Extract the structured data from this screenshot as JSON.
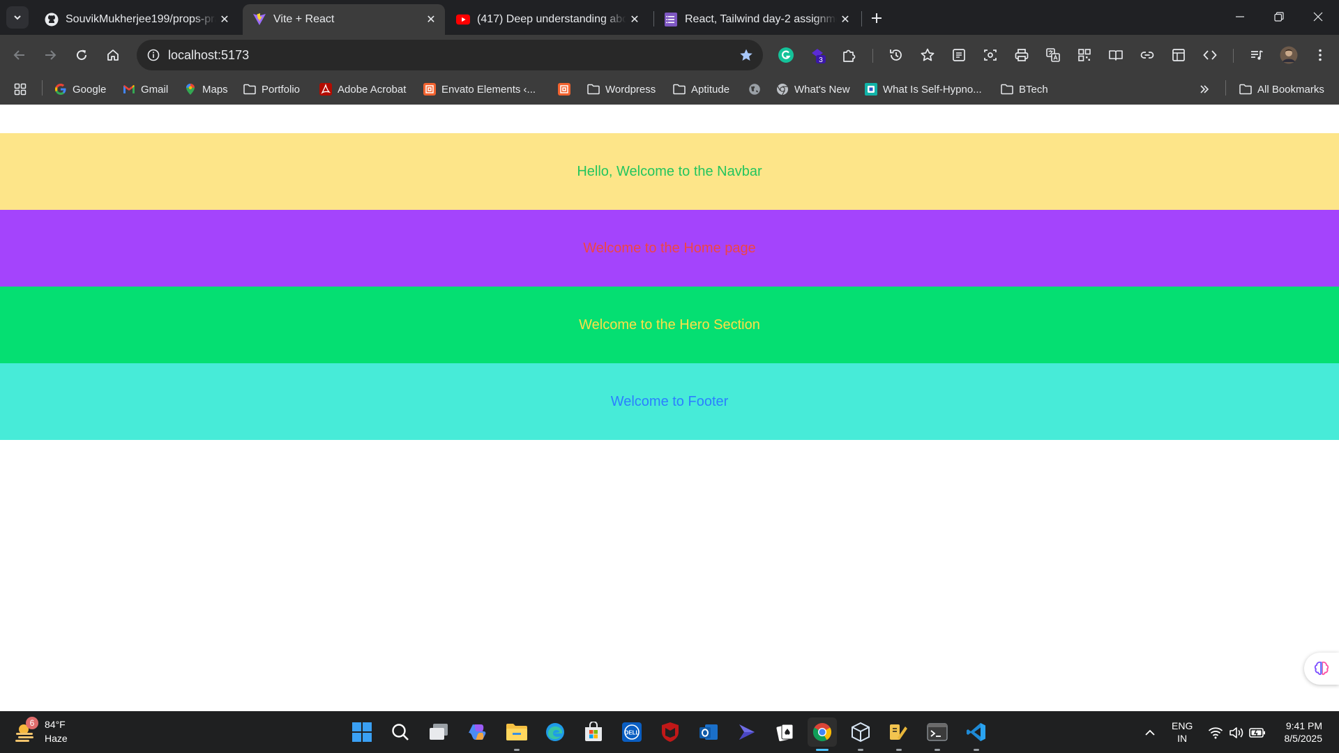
{
  "browser": {
    "tabs": [
      {
        "title": "SouvikMukherjee199/props-pra",
        "icon": "github-icon",
        "active": false
      },
      {
        "title": "Vite + React",
        "icon": "vite-icon",
        "active": true
      },
      {
        "title": "(417) Deep understanding abou",
        "icon": "youtube-icon",
        "active": false
      },
      {
        "title": "React, Tailwind day-2 assignme",
        "icon": "forms-icon",
        "active": false
      }
    ],
    "url": "localhost:5173",
    "extension_badge": "3",
    "bookmarks": [
      {
        "label": "Google",
        "icon": "google-icon"
      },
      {
        "label": "Gmail",
        "icon": "gmail-icon"
      },
      {
        "label": "Maps",
        "icon": "maps-icon"
      },
      {
        "label": "Portfolio",
        "icon": "folder-icon"
      },
      {
        "label": "Adobe Acrobat",
        "icon": "acrobat-icon"
      },
      {
        "label": "Envato Elements ‹...",
        "icon": "envato-icon"
      },
      {
        "label": "",
        "icon": "envato-icon"
      },
      {
        "label": "Wordpress",
        "icon": "folder-icon"
      },
      {
        "label": "Aptitude",
        "icon": "folder-icon"
      },
      {
        "label": "",
        "icon": "globe-icon"
      },
      {
        "label": "What's New",
        "icon": "chrome-icon"
      },
      {
        "label": "What Is Self-Hypno...",
        "icon": "site-icon"
      },
      {
        "label": "BTech",
        "icon": "folder-icon"
      }
    ],
    "all_bookmarks_label": "All Bookmarks"
  },
  "page": {
    "navbar_text": "Hello, Welcome to the Navbar",
    "home_text": "Welcome to the Home page",
    "hero_text": "Welcome to the Hero Section",
    "footer_text": "Welcome to Footer"
  },
  "taskbar": {
    "weather_badge": "6",
    "weather_temp": "84°F",
    "weather_condition": "Haze",
    "language_line1": "ENG",
    "language_line2": "IN",
    "time": "9:41 PM",
    "date": "8/5/2025"
  }
}
